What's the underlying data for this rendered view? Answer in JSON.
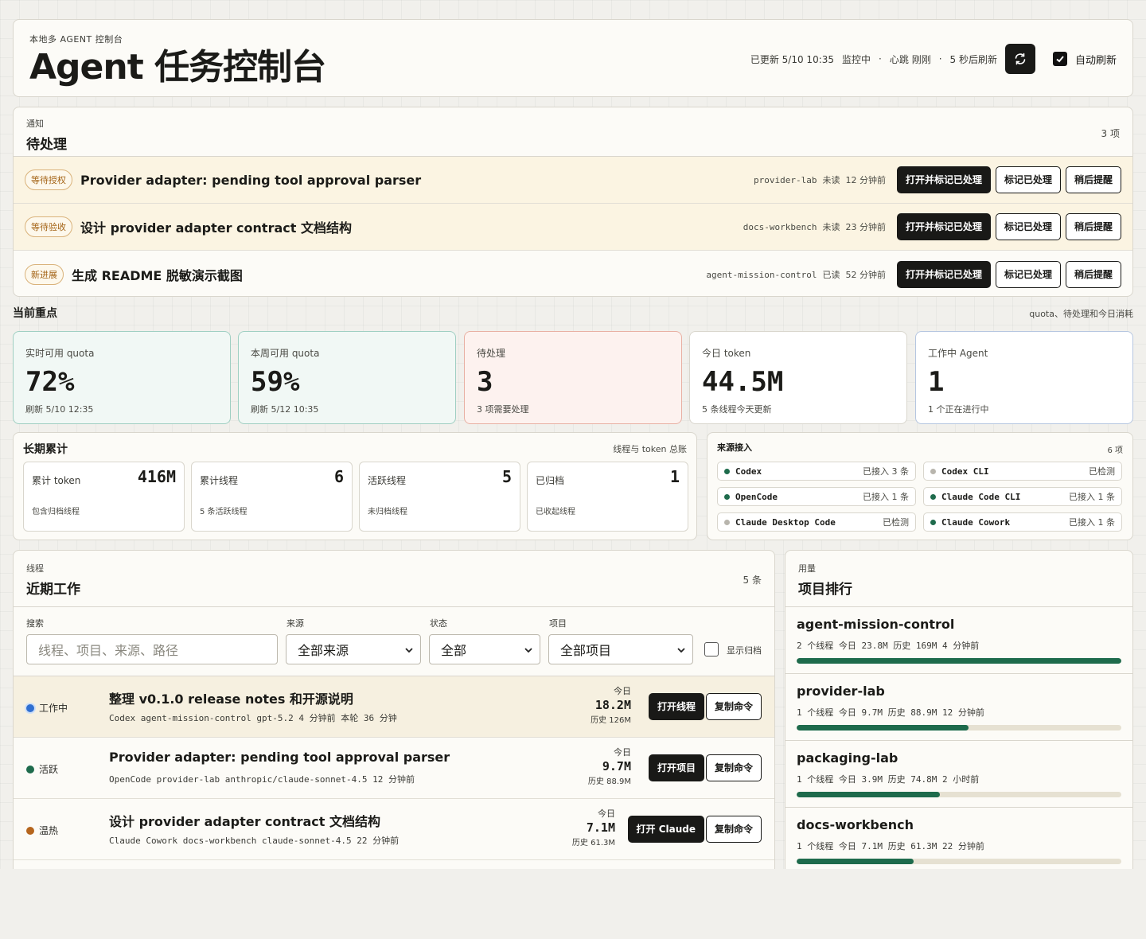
{
  "header": {
    "eyebrow": "本地多 AGENT 控制台",
    "title": "Agent 任务控制台",
    "updated": "已更新 5/10 10:35",
    "status": "监控中",
    "heartbeat": "心跳 刚刚",
    "next_refresh": "5 秒后刷新",
    "auto_refresh_label": "自动刷新",
    "auto_refresh_checked": true
  },
  "notifications": {
    "eyebrow": "通知",
    "title": "待处理",
    "count": "3 项",
    "items": [
      {
        "badge": "等待授权",
        "title": "Provider adapter: pending tool approval parser",
        "project": "provider-lab",
        "read": "未读",
        "time": "12 分钟前",
        "open": "打开并标记已处理",
        "mark": "标记已处理",
        "later": "稍后提醒"
      },
      {
        "badge": "等待验收",
        "title": "设计 provider adapter contract 文档结构",
        "project": "docs-workbench",
        "read": "未读",
        "time": "23 分钟前",
        "open": "打开并标记已处理",
        "mark": "标记已处理",
        "later": "稍后提醒"
      },
      {
        "badge": "新进展",
        "title": "生成 README 脱敏演示截图",
        "project": "agent-mission-control",
        "read": "已读",
        "time": "52 分钟前",
        "open": "打开并标记已处理",
        "mark": "标记已处理",
        "later": "稍后提醒"
      }
    ]
  },
  "focus": {
    "title": "当前重点",
    "note": "quota、待处理和今日消耗",
    "kpis": [
      {
        "label": "实时可用 quota",
        "value": "72%",
        "sub": "刷新 5/10 12:35",
        "bg": "#f1f8f5",
        "border": "#9fcfc2"
      },
      {
        "label": "本周可用 quota",
        "value": "59%",
        "sub": "刷新 5/12 10:35",
        "bg": "#f1f8f5",
        "border": "#9fcfc2"
      },
      {
        "label": "待处理",
        "value": "3",
        "sub": "3 项需要处理",
        "bg": "#fdf2ef",
        "border": "#e8b0a3"
      },
      {
        "label": "今日 token",
        "value": "44.5M",
        "sub": "5 条线程今天更新",
        "bg": "#ffffff",
        "border": "#d9d6cd"
      },
      {
        "label": "工作中 Agent",
        "value": "1",
        "sub": "1 个正在进行中",
        "bg": "#ffffff",
        "border": "#b5c6e0"
      }
    ]
  },
  "longterm": {
    "title": "长期累计",
    "note": "线程与 token 总账",
    "stats": [
      {
        "label": "累计 token",
        "value": "416M",
        "sub": "包含归档线程"
      },
      {
        "label": "累计线程",
        "value": "6",
        "sub": "5 条活跃线程"
      },
      {
        "label": "活跃线程",
        "value": "5",
        "sub": "未归档线程"
      },
      {
        "label": "已归档",
        "value": "1",
        "sub": "已收起线程"
      }
    ]
  },
  "sources": {
    "title": "来源接入",
    "count": "6 项",
    "items": [
      {
        "name": "Codex",
        "status": "已接入 3 条",
        "color": "#1e6b4c"
      },
      {
        "name": "Codex CLI",
        "status": "已检测",
        "color": "#b8b5ad"
      },
      {
        "name": "OpenCode",
        "status": "已接入 1 条",
        "color": "#1e6b4c"
      },
      {
        "name": "Claude Code CLI",
        "status": "已接入 1 条",
        "color": "#1e6b4c"
      },
      {
        "name": "Claude Desktop Code",
        "status": "已检测",
        "color": "#b8b5ad"
      },
      {
        "name": "Claude Cowork",
        "status": "已接入 1 条",
        "color": "#1e6b4c"
      }
    ]
  },
  "threads": {
    "eyebrow": "线程",
    "title": "近期工作",
    "count": "5 条",
    "filters": {
      "search_label": "搜索",
      "search_placeholder": "线程、项目、来源、路径",
      "source_label": "来源",
      "source_value": "全部来源",
      "status_label": "状态",
      "status_value": "全部",
      "project_label": "项目",
      "project_value": "全部项目",
      "archived_label": "显示归档"
    },
    "items": [
      {
        "status": "工作中",
        "status_color": "#2f6fd1",
        "title": "整理 v0.1.0 release notes 和开源说明",
        "meta": "Codex  agent-mission-control  gpt-5.2  4 分钟前  本轮 36 分钟",
        "today_label": "今日",
        "today": "18.2M",
        "history": "历史 126M",
        "open": "打开线程",
        "copy": "复制命令"
      },
      {
        "status": "活跃",
        "status_color": "#1e6b4c",
        "title": "Provider adapter: pending tool approval parser",
        "meta": "OpenCode  provider-lab  anthropic/claude-sonnet-4.5  12 分钟前",
        "today_label": "今日",
        "today": "9.7M",
        "history": "历史 88.9M",
        "open": "打开项目",
        "copy": "复制命令"
      },
      {
        "status": "温热",
        "status_color": "#b5651d",
        "title": "设计 provider adapter contract 文档结构",
        "meta": "Claude Cowork  docs-workbench  claude-sonnet-4.5  22 分钟前",
        "today_label": "今日",
        "today": "7.1M",
        "history": "历史 61.3M",
        "open": "打开 Claude",
        "copy": "复制命令"
      }
    ]
  },
  "ranking": {
    "eyebrow": "用量",
    "title": "项目排行",
    "items": [
      {
        "name": "agent-mission-control",
        "meta": "2 个线程  今日 23.8M  历史 169M  4 分钟前",
        "share": 1.0
      },
      {
        "name": "provider-lab",
        "meta": "1 个线程  今日 9.7M  历史 88.9M  12 分钟前",
        "share": 0.53
      },
      {
        "name": "packaging-lab",
        "meta": "1 个线程  今日 3.9M  历史 74.8M  2 小时前",
        "share": 0.44
      },
      {
        "name": "docs-workbench",
        "meta": "1 个线程  今日 7.1M  历史 61.3M  22 分钟前",
        "share": 0.36
      }
    ]
  }
}
